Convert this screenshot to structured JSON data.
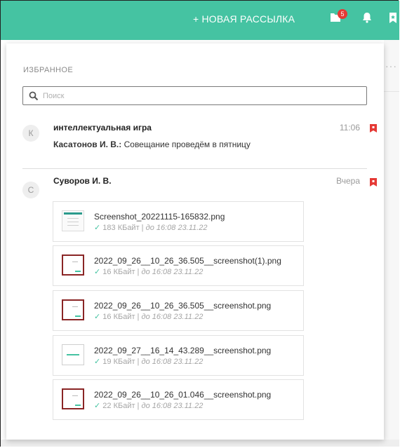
{
  "topbar": {
    "new_mailing": "+ НОВАЯ РАССЫЛКА",
    "badge_count": "5"
  },
  "colors": {
    "accent": "#45c3a2",
    "bookmark": "#e53935",
    "thumb_border": "#8a2525"
  },
  "background": {
    "dots": "···"
  },
  "favorites": {
    "title": "ИЗБРАННОЕ",
    "search": {
      "placeholder": "Поиск",
      "value": ""
    },
    "conversations": [
      {
        "avatar": "К",
        "title": "интеллектуальная игра",
        "time": "11:06",
        "preview_author": "Касатонов И. В.:",
        "preview_text": " Совещание проведём в пятницу"
      },
      {
        "avatar": "С",
        "title": "Суворов И. В.",
        "time": "Вчера",
        "files": [
          {
            "name": "Screenshot_20221115-165832.png",
            "size": "183 КБайт",
            "sep": " | ",
            "expires": "до 16:08 23.11.22"
          },
          {
            "name": "2022_09_26__10_26_36.505__screenshot(1).png",
            "size": "16 КБайт",
            "sep": " | ",
            "expires": "до 16:08 23.11.22"
          },
          {
            "name": "2022_09_26__10_26_36.505__screenshot.png",
            "size": "16 КБайт",
            "sep": " | ",
            "expires": "до 16:08 23.11.22"
          },
          {
            "name": "2022_09_27__16_14_43.289__screenshot.png",
            "size": "19 КБайт",
            "sep": " | ",
            "expires": "до 16:08 23.11.22"
          },
          {
            "name": "2022_09_26__10_26_01.046__screenshot.png",
            "size": "22 КБайт",
            "sep": " | ",
            "expires": "до 16:08 23.11.22"
          }
        ]
      }
    ]
  }
}
